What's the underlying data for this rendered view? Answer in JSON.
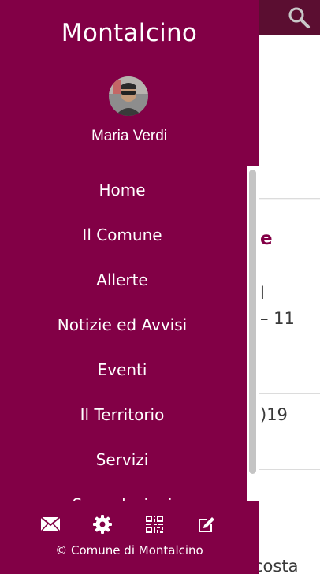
{
  "drawer": {
    "title": "Montalcino",
    "user": {
      "name": "Maria Verdi",
      "avatar_icon": "user-avatar"
    },
    "nav_items": [
      {
        "label": "Home"
      },
      {
        "label": "Il Comune"
      },
      {
        "label": "Allerte"
      },
      {
        "label": "Notizie ed Avvisi"
      },
      {
        "label": "Eventi"
      },
      {
        "label": "Il Territorio"
      },
      {
        "label": "Servizi"
      },
      {
        "label": "Segnalazioni"
      }
    ],
    "footer_icons": [
      "envelope-icon",
      "gear-icon",
      "qr-code-icon",
      "edit-icon"
    ],
    "copyright": "© Comune di Montalcino"
  },
  "background": {
    "search_icon": "search-icon",
    "fragments": [
      "e",
      "l",
      "– 11",
      ")19",
      "costa"
    ]
  },
  "colors": {
    "drawer": "#820046",
    "topbar": "#5b0e31",
    "accent_text": "#820046"
  }
}
